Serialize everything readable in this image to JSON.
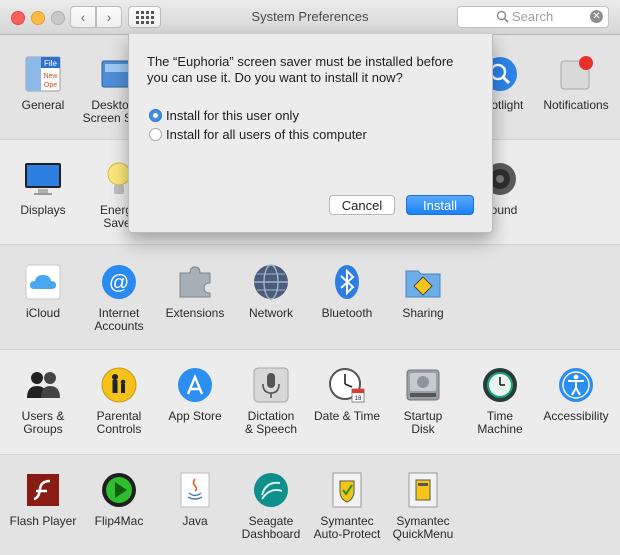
{
  "window": {
    "title": "System Preferences"
  },
  "search": {
    "placeholder": "Search"
  },
  "rows": {
    "personal": [
      {
        "label": "General",
        "icon": "general-icon"
      },
      {
        "label": "Desktop &\nScreen Saver",
        "icon": "desktop-icon"
      },
      {
        "label": "Spotlight",
        "icon": "spotlight-icon"
      },
      {
        "label": "Notifications",
        "icon": "notifications-icon"
      }
    ],
    "hardware": [
      {
        "label": "Displays",
        "icon": "displays-icon"
      },
      {
        "label": "Energy\nSaver",
        "icon": "energy-saver-icon"
      },
      {
        "label": "Sound",
        "icon": "sound-icon"
      }
    ],
    "internet": [
      {
        "label": "iCloud",
        "icon": "icloud-icon"
      },
      {
        "label": "Internet\nAccounts",
        "icon": "internet-accounts-icon"
      },
      {
        "label": "Extensions",
        "icon": "extensions-icon"
      },
      {
        "label": "Network",
        "icon": "network-icon"
      },
      {
        "label": "Bluetooth",
        "icon": "bluetooth-icon"
      },
      {
        "label": "Sharing",
        "icon": "sharing-icon"
      }
    ],
    "system": [
      {
        "label": "Users &\nGroups",
        "icon": "users-groups-icon"
      },
      {
        "label": "Parental\nControls",
        "icon": "parental-controls-icon"
      },
      {
        "label": "App Store",
        "icon": "app-store-icon"
      },
      {
        "label": "Dictation\n& Speech",
        "icon": "microphone-icon"
      },
      {
        "label": "Date & Time",
        "icon": "clock-icon"
      },
      {
        "label": "Startup\nDisk",
        "icon": "disk-icon"
      },
      {
        "label": "Time\nMachine",
        "icon": "time-machine-icon"
      },
      {
        "label": "Accessibility",
        "icon": "accessibility-icon"
      }
    ],
    "other": [
      {
        "label": "Flash Player",
        "icon": "flash-icon"
      },
      {
        "label": "Flip4Mac",
        "icon": "flip4mac-icon"
      },
      {
        "label": "Java",
        "icon": "java-icon"
      },
      {
        "label": "Seagate\nDashboard",
        "icon": "seagate-icon"
      },
      {
        "label": "Symantec\nAuto-Protect",
        "icon": "symantec-icon"
      },
      {
        "label": "Symantec\nQuickMenu",
        "icon": "symantec-quickmenu-icon"
      }
    ]
  },
  "dialog": {
    "message": "The “Euphoria” screen saver must be installed before you can use it. Do you want to install it now?",
    "options": [
      {
        "label": "Install for this user only",
        "selected": true
      },
      {
        "label": "Install for all users of this computer",
        "selected": false
      }
    ],
    "cancel_label": "Cancel",
    "install_label": "Install"
  },
  "colors": {
    "accent": "#1a82f6",
    "notification_badge": "#e8302c"
  }
}
